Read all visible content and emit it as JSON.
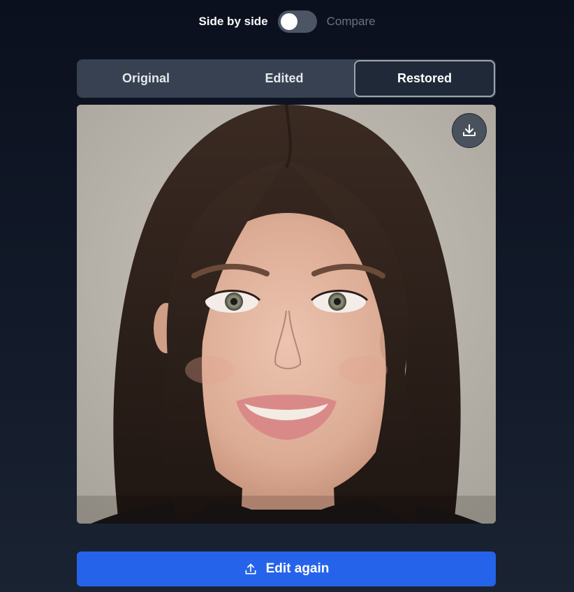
{
  "view_toggle": {
    "left_label": "Side by side",
    "right_label": "Compare",
    "enabled": false
  },
  "tabs": [
    {
      "label": "Original",
      "active": false
    },
    {
      "label": "Edited",
      "active": false
    },
    {
      "label": "Restored",
      "active": true
    }
  ],
  "image": {
    "subject": "portrait photo of a smiling woman with long dark hair",
    "download_icon": "download-icon"
  },
  "actions": {
    "edit_again_label": "Edit again",
    "edit_again_icon": "upload-icon"
  },
  "colors": {
    "background": "#111827",
    "tab_bar": "#374151",
    "tab_active": "#1f2937",
    "primary": "#2563eb",
    "toggle_off": "#4b5563"
  }
}
